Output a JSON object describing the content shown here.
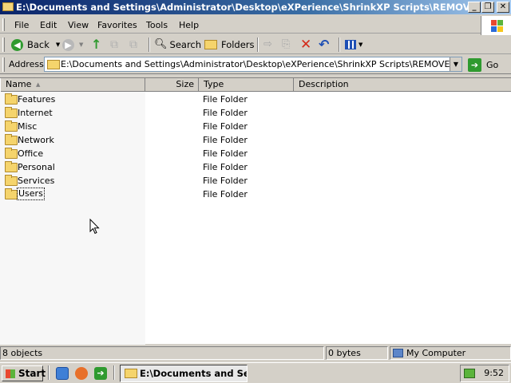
{
  "window": {
    "title": "E:\\Documents and Settings\\Administrator\\Desktop\\eXPerience\\ShrinkXP Scripts\\REMOVE",
    "minimize": "_",
    "maximize": "❐",
    "close": "✕"
  },
  "menu": {
    "items": [
      "File",
      "Edit",
      "View",
      "Favorites",
      "Tools",
      "Help"
    ]
  },
  "toolbar": {
    "back_label": "Back",
    "search_label": "Search",
    "folders_label": "Folders"
  },
  "address": {
    "label": "Address",
    "value": "E:\\Documents and Settings\\Administrator\\Desktop\\eXPerience\\ShrinkXP Scripts\\REMOVE",
    "go_label": "Go"
  },
  "columns": {
    "name": "Name",
    "size": "Size",
    "type": "Type",
    "description": "Description"
  },
  "files": [
    {
      "name": "Features",
      "type": "File Folder"
    },
    {
      "name": "Internet",
      "type": "File Folder"
    },
    {
      "name": "Misc",
      "type": "File Folder"
    },
    {
      "name": "Network",
      "type": "File Folder"
    },
    {
      "name": "Office",
      "type": "File Folder"
    },
    {
      "name": "Personal",
      "type": "File Folder"
    },
    {
      "name": "Services",
      "type": "File Folder"
    },
    {
      "name": "Users",
      "type": "File Folder"
    }
  ],
  "status": {
    "objects": "8 objects",
    "size": "0 bytes",
    "zone": "My Computer"
  },
  "taskbar": {
    "start_label": "Start",
    "task_label": "E:\\Documents and Se...",
    "clock": "9:52"
  },
  "colors": {
    "title_gradient_start": "#0a246a",
    "title_gradient_end": "#a6caf0",
    "face": "#d4d0c8",
    "delete_red": "#d42a1a",
    "go_green": "#2f9a2f"
  }
}
